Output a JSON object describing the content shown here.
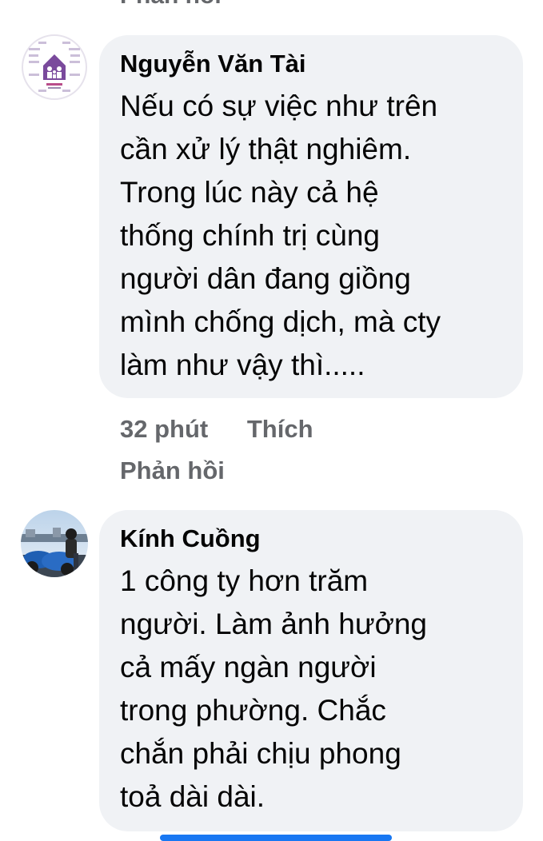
{
  "top_cut": {
    "text": "Phản hồi"
  },
  "comments": [
    {
      "author": "Nguyễn Văn Tài",
      "text": "Nếu có sự việc như trên\ncần xử lý thật nghiêm.\nTrong lúc này cả hệ\nthống chính trị cùng\nngười dân đang giồng\nmình chống dịch, mà cty\nlàm như vậy thì.....",
      "time": "32 phút",
      "like_label": "Thích",
      "reply_label": "Phản hồi",
      "avatar_icon": "family-house-infographic-icon"
    },
    {
      "author": "Kính Cuồng",
      "text": "1 công ty hơn trăm\nngười. Làm ảnh hưởng\ncả mấy ngàn người\ntrong phường. Chắc\nchắn phải chịu phong\ntoả dài dài.",
      "avatar_icon": "motorcycle-photo-icon"
    }
  ],
  "colors": {
    "bubble": "#f0f2f5",
    "meta_text": "#65676b",
    "accent": "#1877f2"
  }
}
